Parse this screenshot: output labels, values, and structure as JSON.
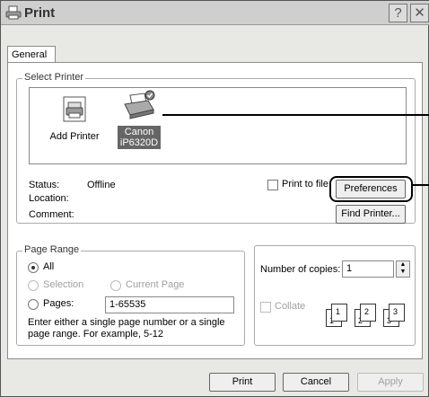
{
  "window": {
    "title": "Print",
    "help_glyph": "?",
    "close_glyph": "✕"
  },
  "tabs": [
    {
      "label": "General"
    }
  ],
  "select_printer": {
    "legend": "Select Printer",
    "printers": [
      {
        "label": "Add Printer",
        "icon": "add-printer-icon"
      },
      {
        "label_line1": "Canon",
        "label_line2": "iP6320D",
        "icon": "printer-icon",
        "selected": true
      }
    ],
    "status_label": "Status:",
    "status_value": "Offline",
    "location_label": "Location:",
    "comment_label": "Comment:",
    "print_to_file_label": "Print to file",
    "print_to_file_checked": false,
    "preferences_label": "Preferences",
    "find_printer_label": "Find Printer..."
  },
  "page_range": {
    "legend": "Page Range",
    "all_label": "All",
    "selection_label": "Selection",
    "current_page_label": "Current Page",
    "pages_label": "Pages:",
    "pages_value": "1-65535",
    "hint_line1": "Enter either a single page number or a single",
    "hint_line2": "page range.  For example, 5-12",
    "selected": "All"
  },
  "copies": {
    "number_label": "Number of copies:",
    "number_value": "1",
    "collate_label": "Collate",
    "collate_checked": false,
    "collate_pages": [
      "1",
      "1",
      "2",
      "2",
      "3",
      "3"
    ]
  },
  "footer": {
    "print_label": "Print",
    "cancel_label": "Cancel",
    "apply_label": "Apply"
  }
}
